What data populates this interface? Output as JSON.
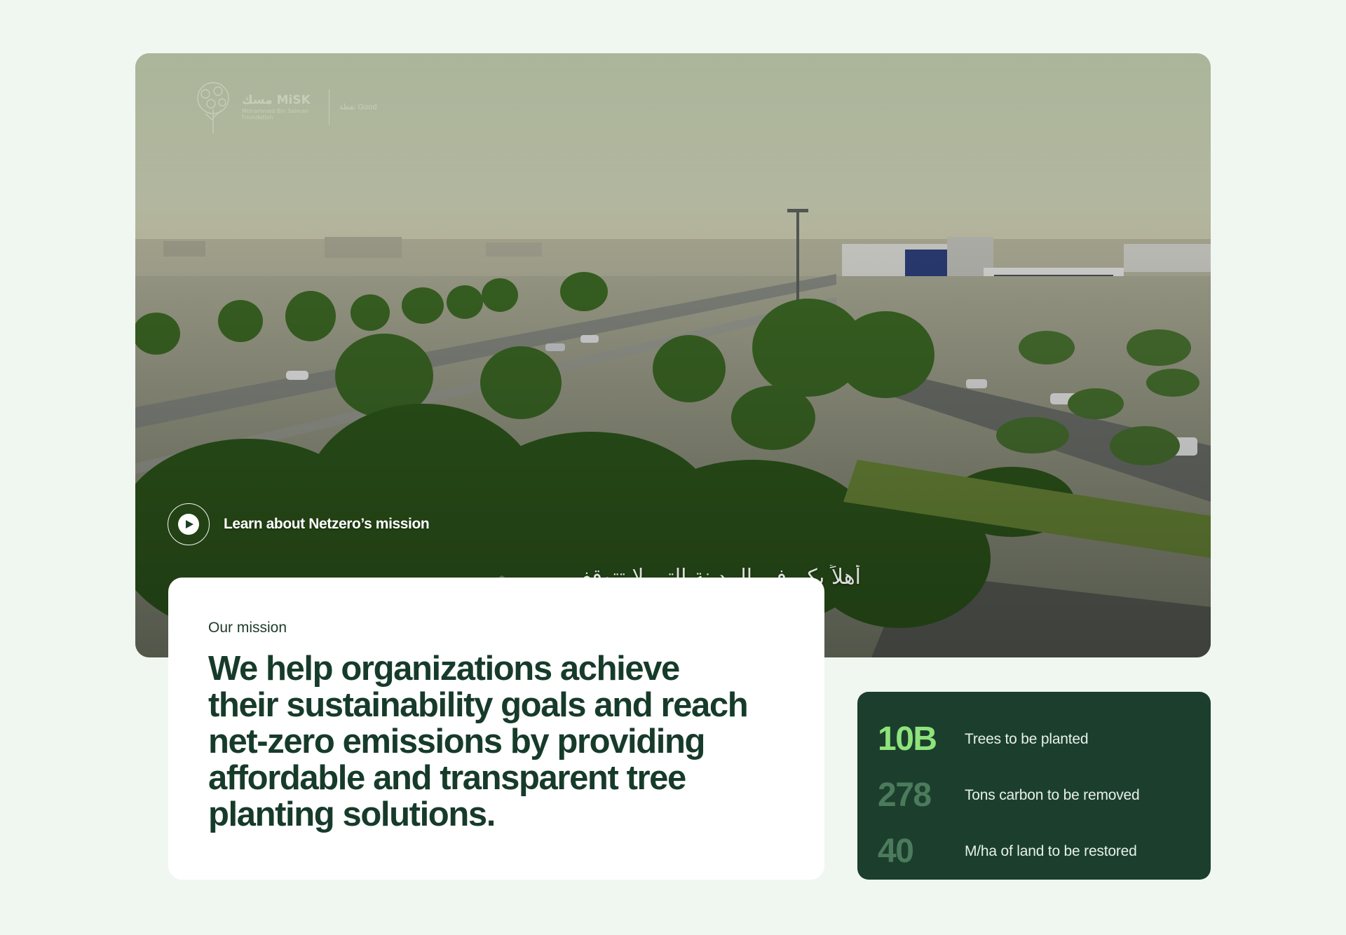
{
  "video": {
    "logo_name": "مسك MiSK",
    "logo_sub": "Mohammed Bin Salman Foundation",
    "logo_partner": "نقطة Good",
    "play_label": "Learn about Netzero’s mission",
    "subtitle_ar": "أهلاً بكم في المدينة التي لا تتوقف",
    "colors": {
      "sky": "#b9c3a6",
      "foliage": "#3f6b26",
      "road": "#7c8079"
    }
  },
  "mission": {
    "eyebrow": "Our mission",
    "statement": "We help organizations achieve their sustainability goals and reach net-zero emissions by providing affordable and transparent tree planting solutions."
  },
  "stats": [
    {
      "value": "10B",
      "label": "Trees to be planted",
      "active": true
    },
    {
      "value": "278",
      "label": "Tons carbon to be removed",
      "active": false
    },
    {
      "value": "40",
      "label": "M/ha of land to be restored",
      "active": false
    }
  ],
  "colors": {
    "page_background": "#f0f7f1",
    "card_dark": "#1b3f2c",
    "accent_green": "#8fe37c",
    "muted_green": "#4c7a5c",
    "heading": "#173b2a"
  },
  "icons": {
    "play": "play-icon",
    "logo": "tree-logo-icon"
  }
}
